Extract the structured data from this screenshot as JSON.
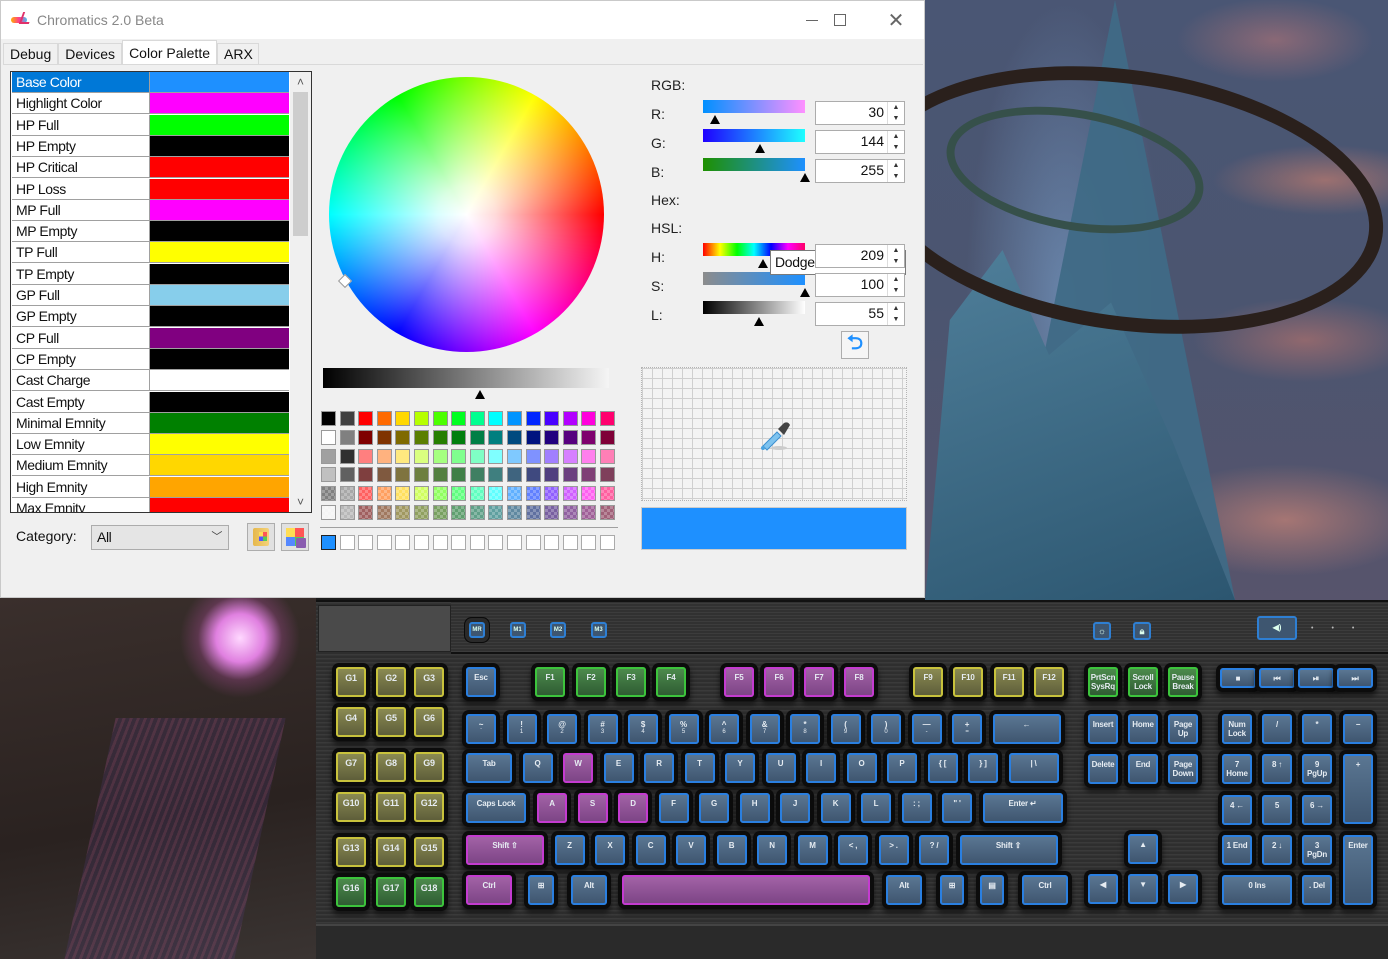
{
  "window": {
    "title": "Chromatics 2.0 Beta",
    "controls": {
      "minimize": "minimize",
      "maximize": "maximize",
      "close": "close"
    }
  },
  "tabs": [
    {
      "label": "Debug",
      "active": false
    },
    {
      "label": "Devices",
      "active": false
    },
    {
      "label": "Color Palette",
      "active": true
    },
    {
      "label": "ARX",
      "active": false
    }
  ],
  "color_list": {
    "selected": "Base Color",
    "items": [
      {
        "label": "Base Color",
        "color": "#1e90ff"
      },
      {
        "label": "Highlight Color",
        "color": "#ff00ff"
      },
      {
        "label": "HP Full",
        "color": "#00ff00"
      },
      {
        "label": "HP Empty",
        "color": "#000000"
      },
      {
        "label": "HP Critical",
        "color": "#ff0000"
      },
      {
        "label": "HP Loss",
        "color": "#ff0000"
      },
      {
        "label": "MP Full",
        "color": "#ff00ff"
      },
      {
        "label": "MP Empty",
        "color": "#000000"
      },
      {
        "label": "TP Full",
        "color": "#ffff00"
      },
      {
        "label": "TP Empty",
        "color": "#000000"
      },
      {
        "label": "GP Full",
        "color": "#87ceeb"
      },
      {
        "label": "GP Empty",
        "color": "#000000"
      },
      {
        "label": "CP Full",
        "color": "#800080"
      },
      {
        "label": "CP Empty",
        "color": "#000000"
      },
      {
        "label": "Cast Charge",
        "color": "#ffffff"
      },
      {
        "label": "Cast Empty",
        "color": "#000000"
      },
      {
        "label": "Minimal Emnity",
        "color": "#008000"
      },
      {
        "label": "Low Emnity",
        "color": "#ffff00"
      },
      {
        "label": "Medium Emnity",
        "color": "#ffd700"
      },
      {
        "label": "High Emnity",
        "color": "#ffa500"
      },
      {
        "label": "Max Emnity",
        "color": "#ff0000"
      }
    ],
    "scroll_up": "˄",
    "scroll_down": "˅"
  },
  "category": {
    "label": "Category:",
    "value": "All",
    "chevron": "﹀"
  },
  "buttons": {
    "open_palette": "open-palette-icon",
    "save_palette": "save-palette-icon",
    "revert": "⮌"
  },
  "picker": {
    "luminance_value": 0.55,
    "palette_rows": [
      [
        "#000000",
        "#404040",
        "#ff0000",
        "#ff6a00",
        "#ffd800",
        "#b6ff00",
        "#4cff00",
        "#00ff21",
        "#00ff90",
        "#00ffff",
        "#0094ff",
        "#0026ff",
        "#4800ff",
        "#b200ff",
        "#ff00dc",
        "#ff006e"
      ],
      [
        "#ffffff",
        "#808080",
        "#7f0000",
        "#7f3300",
        "#7f6a00",
        "#5b7f00",
        "#267f00",
        "#007f0e",
        "#007f46",
        "#007f7f",
        "#004a7f",
        "#00137f",
        "#21007f",
        "#57007f",
        "#7f006e",
        "#7f0037"
      ],
      [
        "#a0a0a0",
        "#303030",
        "#ff7f7f",
        "#ffb27f",
        "#ffe97f",
        "#daff7f",
        "#a5ff7f",
        "#7fff8e",
        "#7fffc5",
        "#7fffff",
        "#7fc9ff",
        "#7f92ff",
        "#a17fff",
        "#d67fff",
        "#ff7fed",
        "#ff7fb6"
      ],
      [
        "#c0c0c0",
        "#606060",
        "#7f3f3f",
        "#7f593f",
        "#7f743f",
        "#6d7f3f",
        "#527f3f",
        "#3f7f47",
        "#3f7f62",
        "#3f7f7f",
        "#3f647f",
        "#3f497f",
        "#503f7f",
        "#6b3f7f",
        "#7f3f76",
        "#7f3f5b"
      ],
      [
        "#808080",
        "#a8a8a8",
        "#ff6060",
        "#ffa060",
        "#ffe060",
        "#d0ff60",
        "#90ff60",
        "#60ff80",
        "#60ffc0",
        "#60ffff",
        "#60b0ff",
        "#6080ff",
        "#9060ff",
        "#d060ff",
        "#ff60f0",
        "#ff60a0"
      ],
      [
        "#f4f4f4",
        "#b8b8b8",
        "#a06060",
        "#a07860",
        "#a09860",
        "#90a060",
        "#78a060",
        "#60a070",
        "#60a088",
        "#60a0a0",
        "#6088a0",
        "#6070a0",
        "#7860a0",
        "#9060a0",
        "#a06098",
        "#a06078"
      ]
    ],
    "custom_colors": [
      "#1e90ff",
      "#ffffff",
      "#ffffff",
      "#ffffff",
      "#ffffff",
      "#ffffff",
      "#ffffff",
      "#ffffff",
      "#ffffff",
      "#ffffff",
      "#ffffff",
      "#ffffff",
      "#ffffff",
      "#ffffff",
      "#ffffff",
      "#ffffff"
    ]
  },
  "rgb": {
    "label": "RGB:",
    "r": {
      "label": "R:",
      "value": "30"
    },
    "g": {
      "label": "G:",
      "value": "144"
    },
    "b": {
      "label": "B:",
      "value": "255"
    }
  },
  "hex": {
    "label": "Hex:",
    "value": "DodgerBlue",
    "chevron": "﹀"
  },
  "hsl": {
    "label": "HSL:",
    "h": {
      "label": "H:",
      "value": "209"
    },
    "s": {
      "label": "S:",
      "value": "100"
    },
    "l": {
      "label": "L:",
      "value": "55"
    }
  },
  "spin": {
    "up": "▲",
    "down": "▼"
  },
  "preview_color": "#1e90ff",
  "keyboard": {
    "macro_buttons": [
      "MR",
      "M1",
      "M2",
      "M3"
    ],
    "top_icons": [
      "brightness-icon",
      "lock-icon"
    ],
    "media_keys": [
      "■",
      "⏮",
      "⏯",
      "⏭"
    ],
    "mute_label": "◀)",
    "gkeys": [
      "G1",
      "G2",
      "G3",
      "G4",
      "G5",
      "G6",
      "G7",
      "G8",
      "G9",
      "G10",
      "G11",
      "G12",
      "G13",
      "G14",
      "G15",
      "G16",
      "G17",
      "G18"
    ],
    "fn_row": [
      "Esc",
      "F1",
      "F2",
      "F3",
      "F4",
      "F5",
      "F6",
      "F7",
      "F8",
      "F9",
      "F10",
      "F11",
      "F12",
      "PrtScn SysRq",
      "Scroll Lock",
      "Pause Break"
    ],
    "num_row": [
      [
        "~",
        "`"
      ],
      [
        "!",
        "1"
      ],
      [
        "@",
        "2"
      ],
      [
        "#",
        "3"
      ],
      [
        "$",
        "4"
      ],
      [
        "%",
        "5"
      ],
      [
        "^",
        "6"
      ],
      [
        "&",
        "7"
      ],
      [
        "*",
        "8"
      ],
      [
        "(",
        "9"
      ],
      [
        ")",
        "0"
      ],
      [
        "—",
        "-"
      ],
      [
        "+",
        "="
      ],
      [
        "←",
        ""
      ]
    ],
    "tab_row": [
      "Tab",
      "Q",
      "W",
      "E",
      "R",
      "T",
      "Y",
      "U",
      "I",
      "O",
      "P",
      "{ [",
      "} ]",
      "| \\"
    ],
    "caps_row": [
      "Caps Lock",
      "A",
      "S",
      "D",
      "F",
      "G",
      "H",
      "J",
      "K",
      "L",
      ": ;",
      "\" '",
      "Enter ↵"
    ],
    "shift_row": [
      "Shift ⇧",
      "Z",
      "X",
      "C",
      "V",
      "B",
      "N",
      "M",
      "< ,",
      "> .",
      "? /",
      "Shift ⇧"
    ],
    "ctrl_row": [
      "Ctrl",
      "⊞",
      "Alt",
      "",
      "Alt",
      "⊞",
      "▤",
      "Ctrl"
    ],
    "nav": [
      "Insert",
      "Home",
      "Page Up",
      "Delete",
      "End",
      "Page Down"
    ],
    "arrows": [
      "▲",
      "◀",
      "▼",
      "▶"
    ],
    "numpad": [
      "Num Lock",
      "/",
      "*",
      "−",
      "7 Home",
      "8 ↑",
      "9 PgUp",
      "+",
      "4 ←",
      "5",
      "6 →",
      "1 End",
      "2 ↓",
      "3 PgDn",
      "Enter",
      "0 Ins",
      ". Del"
    ]
  }
}
